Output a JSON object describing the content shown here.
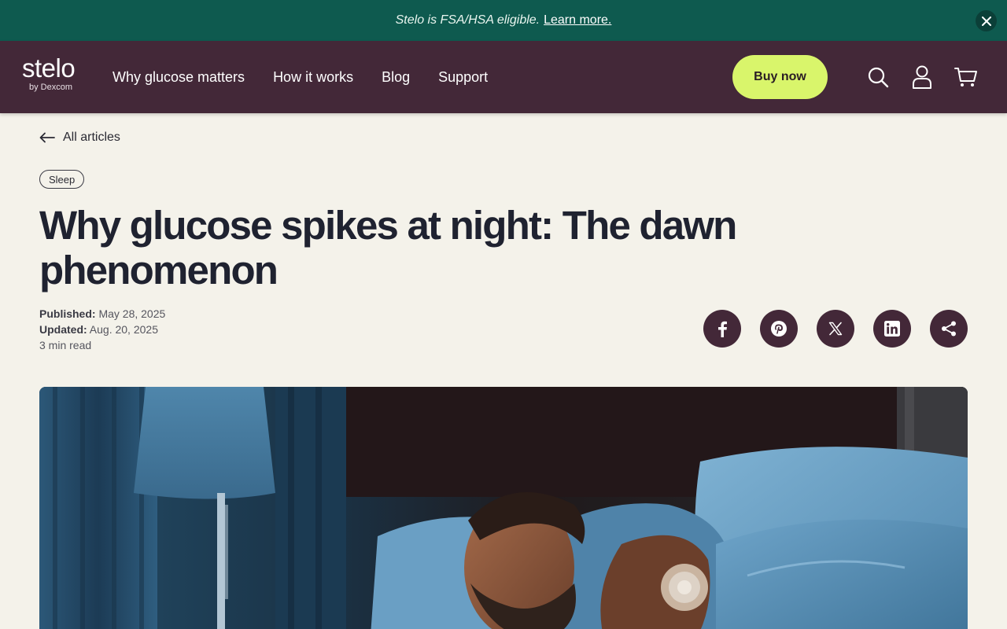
{
  "announcement": {
    "message": "Stelo is FSA/HSA eligible.",
    "link_label": "Learn more."
  },
  "header": {
    "logo_word": "stelo",
    "logo_sub": "by Dexcom",
    "nav": [
      {
        "label": "Why glucose matters"
      },
      {
        "label": "How it works"
      },
      {
        "label": "Blog"
      },
      {
        "label": "Support"
      }
    ],
    "buy_label": "Buy now",
    "icons": [
      "search-icon",
      "account-icon",
      "cart-icon"
    ]
  },
  "article": {
    "back_label": "All articles",
    "tag": "Sleep",
    "title": "Why glucose spikes at night: The dawn phenomenon",
    "published_label": "Published:",
    "published_date": "May 28, 2025",
    "updated_label": "Updated:",
    "updated_date": "Aug. 20, 2025",
    "read_time": "3 min read",
    "share_icons": [
      "facebook-icon",
      "pinterest-icon",
      "x-icon",
      "linkedin-icon",
      "share-icon"
    ]
  },
  "colors": {
    "announcement_bg": "#0e5a4f",
    "header_bg": "#432838",
    "buy_button_bg": "#d9f56b",
    "page_bg": "#f4f2ea",
    "share_button_bg": "#432838"
  }
}
